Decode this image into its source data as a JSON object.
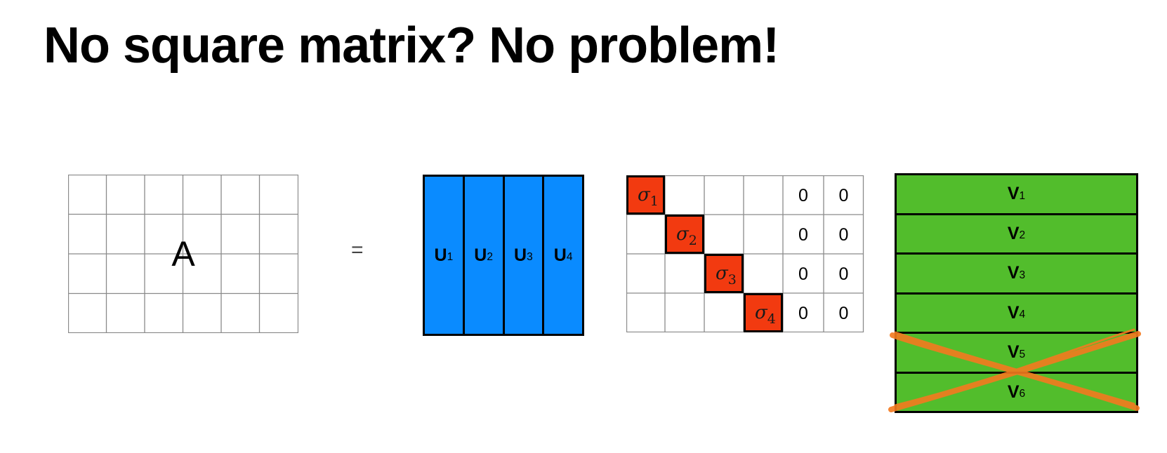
{
  "title": "No square matrix? No problem!",
  "matrix_a": {
    "label": "A",
    "rows": 4,
    "cols": 6
  },
  "equals": "=",
  "matrix_u": {
    "color": "#0a8bff",
    "columns": [
      {
        "base": "U",
        "index": "1"
      },
      {
        "base": "U",
        "index": "2"
      },
      {
        "base": "U",
        "index": "3"
      },
      {
        "base": "U",
        "index": "4"
      }
    ]
  },
  "matrix_sigma": {
    "highlight_color": "#f23a10",
    "diagonal": [
      {
        "symbol": "σ",
        "index": "1"
      },
      {
        "symbol": "σ",
        "index": "2"
      },
      {
        "symbol": "σ",
        "index": "3"
      },
      {
        "symbol": "σ",
        "index": "4"
      }
    ],
    "zero_columns": [
      [
        "0",
        "0"
      ],
      [
        "0",
        "0"
      ],
      [
        "0",
        "0"
      ],
      [
        "0",
        "0"
      ]
    ]
  },
  "matrix_v": {
    "color": "#52bd2c",
    "rows": [
      {
        "base": "V",
        "index": "1",
        "crossed": false
      },
      {
        "base": "V",
        "index": "2",
        "crossed": false
      },
      {
        "base": "V",
        "index": "3",
        "crossed": false
      },
      {
        "base": "V",
        "index": "4",
        "crossed": false
      },
      {
        "base": "V",
        "index": "5",
        "crossed": true
      },
      {
        "base": "V",
        "index": "6",
        "crossed": true
      }
    ],
    "cross_color": "#f47a1f"
  }
}
